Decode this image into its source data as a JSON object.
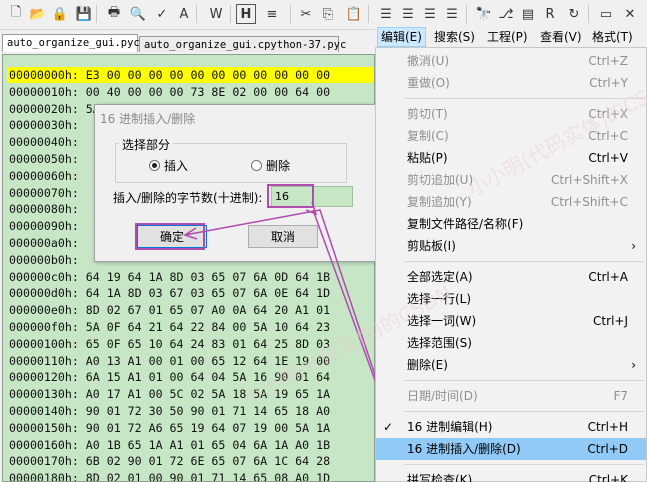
{
  "toolbar": {
    "icons": [
      "new-file-icon",
      "open-folder-icon",
      "open-locked-icon",
      "save-icon",
      "print-icon",
      "print-preview-icon",
      "spellcheck-icon",
      "font-icon",
      "word-wrap-icon",
      "hex-mode-icon",
      "justify-icon",
      "cut-icon",
      "copy-icon",
      "paste-icon",
      "align-left-icon",
      "align-center-icon",
      "align-right-icon",
      "align-justify-icon",
      "find-icon",
      "binoculars-replace-icon",
      "find-in-files-icon",
      "replace-icon",
      "find-next-icon",
      "window-icon",
      "close-window-icon"
    ]
  },
  "tabs": [
    {
      "label": "auto_organize_gui.pyc"
    },
    {
      "label": "auto_organize_gui.cpython-37.pyc"
    }
  ],
  "hex_rows": [
    "00000000h: E3 00 00 00 00 00 00 00 00 00 00 00",
    "00000010h: 00 40 00 00 00 73 8E 02 00 00 64 00",
    "00000020h: 5A 01 64 02 5A 03 64 03 64 04 6C 05",
    "00000030h: ",
    "00000040h: ",
    "00000050h: ",
    "00000060h: ",
    "00000070h: ",
    "00000080h: ",
    "00000090h: ",
    "000000a0h: ",
    "000000b0h: ",
    "000000c0h: 64 19 64 1A 8D 03 65 07 6A 0D 64 1B",
    "000000d0h: 64 1A 8D 03 67 03 65 07 6A 0E 64 1D",
    "000000e0h: 8D 02 67 01 65 07 A0 0A 64 20 A1 01",
    "000000f0h: 5A 0F 64 21 64 22 84 00 5A 10 64 23",
    "00000100h: 65 0F 65 10 64 24 83 01 64 25 8D 03",
    "00000110h: A0 13 A1 00 01 00 65 12 64 1E 19 00",
    "00000120h: 6A 15 A1 01 00 64 04 5A 16 90 01 64",
    "00000130h: A0 17 A1 00 5C 02 5A 18 5A 19 65 1A",
    "00000140h: 90 01 72 30 50 90 01 71 14 65 18 A0",
    "00000150h: 90 01 72 A6 65 19 64 07 19 00 5A 1A",
    "00000160h: A0 1B 65 1A A1 01 65 04 6A 1A A0 1B",
    "00000170h: 6B 02 90 01 72 6E 65 07 6A 1C 64 28",
    "00000180h: 8D 02 01 00 90 01 71 14 65 08 A0 1D",
    "00000190h: 5A 16 78 1C 65 16 44 00 5D 14 5C 02"
  ],
  "dialog": {
    "title": "16 进制插入/删除",
    "group_label": "选择部分",
    "radio_insert": "插入",
    "radio_delete": "删除",
    "selected": "插入",
    "count_label": "插入/删除的字节数(十进制):",
    "count_value": "16",
    "ok": "确定",
    "cancel": "取消"
  },
  "menubar": [
    {
      "label": "编辑(E)",
      "active": true
    },
    {
      "label": "搜索(S)"
    },
    {
      "label": "工程(P)"
    },
    {
      "label": "查看(V)"
    },
    {
      "label": "格式(T)"
    }
  ],
  "menu_items": [
    {
      "label": "撤消(U)",
      "shortcut": "Ctrl+Z",
      "disabled": true
    },
    {
      "label": "重做(O)",
      "shortcut": "Ctrl+Y",
      "disabled": true
    },
    {
      "sep": true
    },
    {
      "label": "剪切(T)",
      "shortcut": "Ctrl+X",
      "disabled": true
    },
    {
      "label": "复制(C)",
      "shortcut": "Ctrl+C",
      "disabled": true
    },
    {
      "label": "粘贴(P)",
      "shortcut": "Ctrl+V"
    },
    {
      "label": "剪切追加(U)",
      "shortcut": "Ctrl+Shift+X",
      "disabled": true
    },
    {
      "label": "复制追加(Y)",
      "shortcut": "Ctrl+Shift+C",
      "disabled": true
    },
    {
      "label": "复制文件路径/名称(F)"
    },
    {
      "label": "剪贴板(I)",
      "submenu": true
    },
    {
      "sep": true
    },
    {
      "label": "全部选定(A)",
      "shortcut": "Ctrl+A"
    },
    {
      "label": "选择一行(L)"
    },
    {
      "label": "选择一词(W)",
      "shortcut": "Ctrl+J"
    },
    {
      "label": "选择范围(S)"
    },
    {
      "label": "删除(E)",
      "submenu": true
    },
    {
      "sep": true
    },
    {
      "label": "日期/时间(D)",
      "shortcut": "F7",
      "disabled": true
    },
    {
      "sep": true
    },
    {
      "label": "16 进制编辑(H)",
      "shortcut": "Ctrl+H",
      "checked": true
    },
    {
      "label": "16 进制插入/删除(D)",
      "shortcut": "Ctrl+D",
      "highlighted": true
    },
    {
      "sep": true
    },
    {
      "label": "拼写检查(K)",
      "shortcut": "Ctrl+K"
    }
  ],
  "colors": {
    "hex_bg": "#c6e6c6",
    "selection": "#ffff00",
    "menu_hot": "#91c9f7",
    "annotation": "#b04bb0"
  },
  "watermark": "小小明(代码实体)的CSDN"
}
